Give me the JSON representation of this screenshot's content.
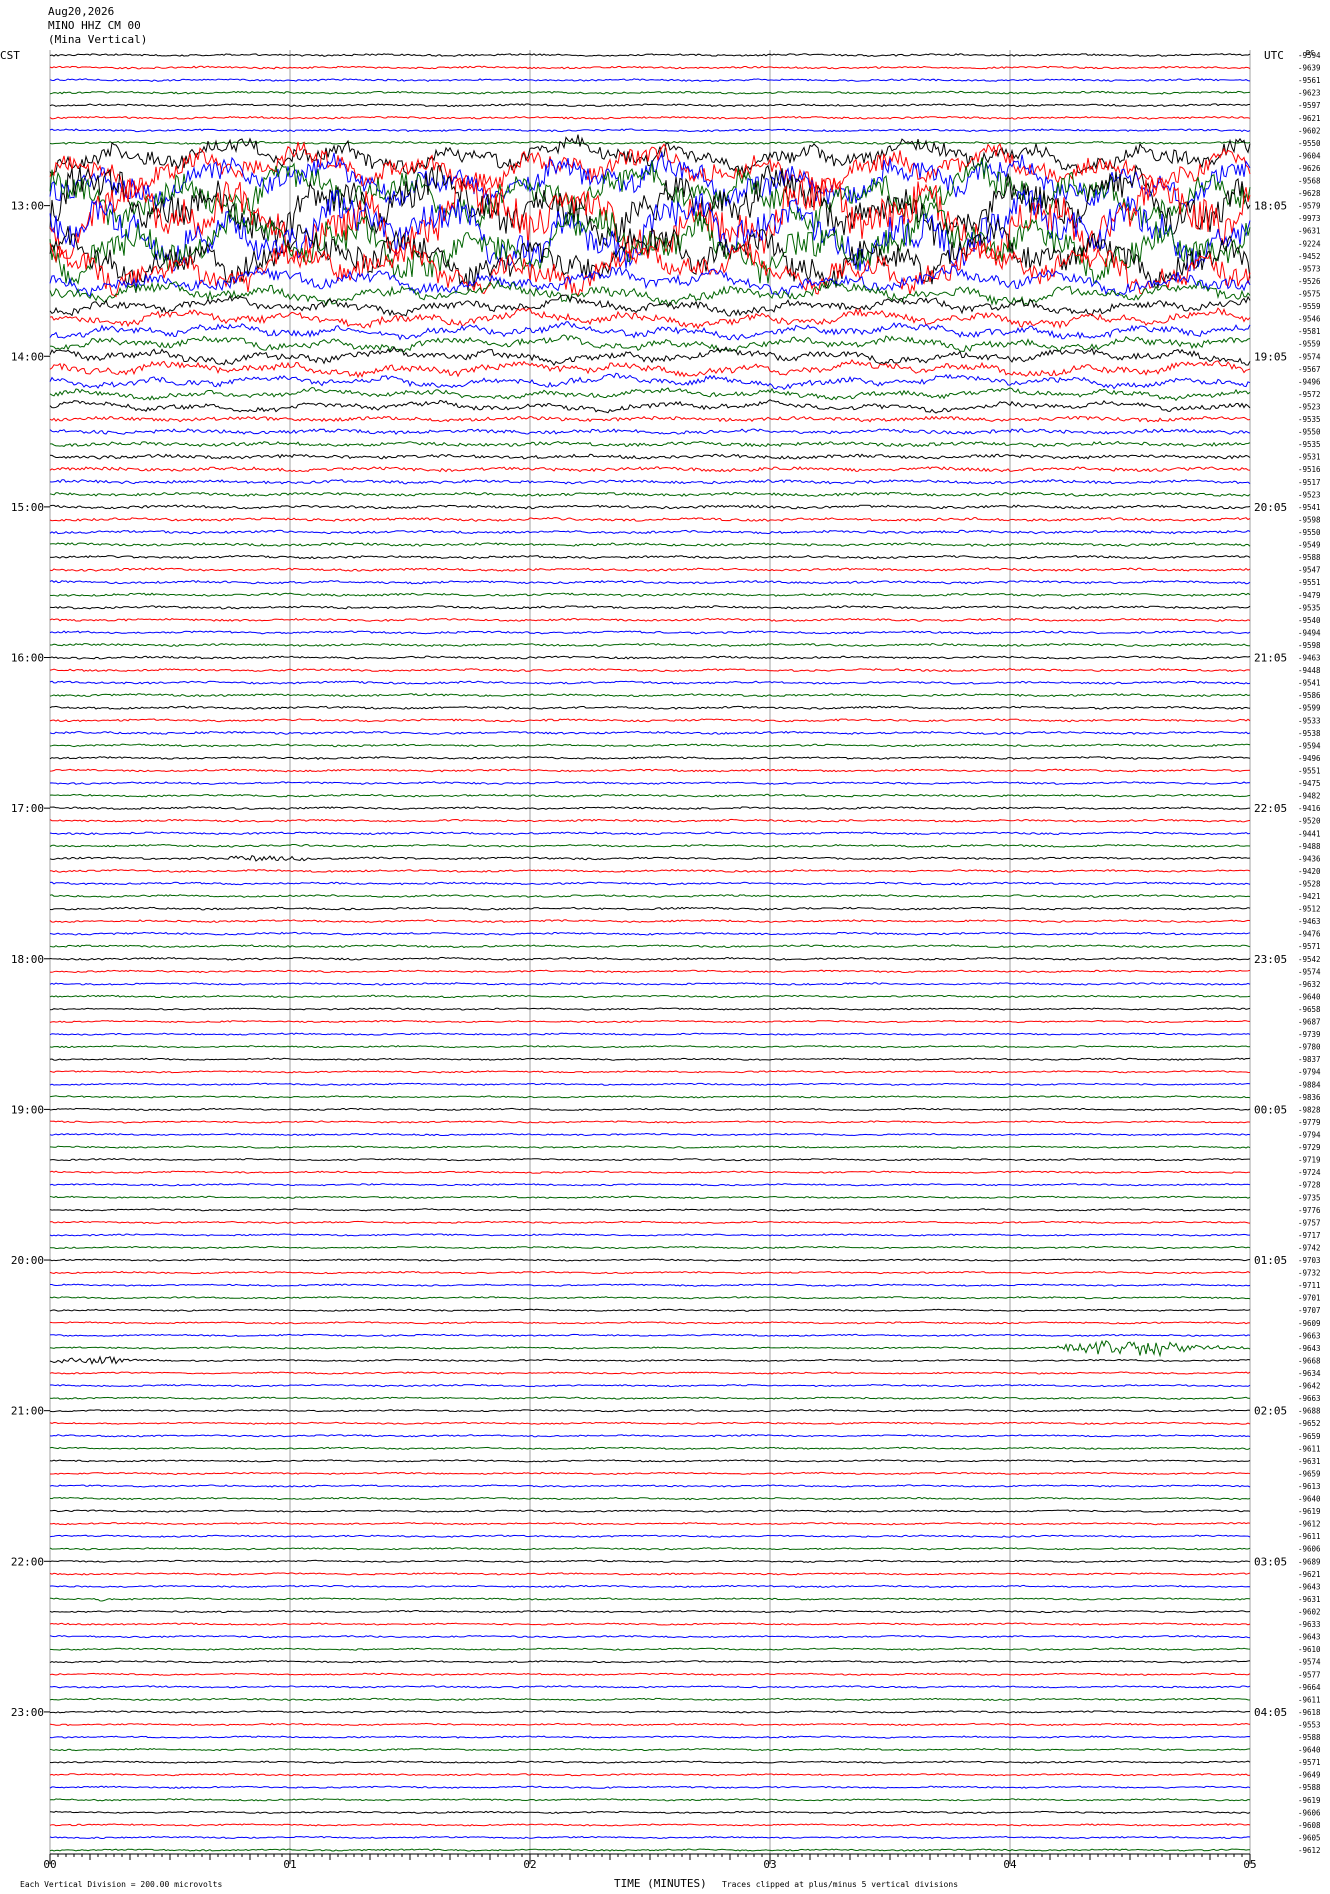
{
  "header": {
    "date": "Aug20,2026",
    "station": "MINO HHZ CM 00",
    "location": "(Mina Vertical)"
  },
  "left_zone_label": "CST",
  "right_zone_label": "UTC",
  "top_right_mark": "DC",
  "footer": {
    "scale_note": "Each Vertical Division = 200.00 microvolts",
    "axis_title": "TIME (MINUTES)",
    "clip_note": "Traces clipped at plus/minus 5 vertical divisions"
  },
  "colors": {
    "trace_cycle": [
      "#000000",
      "#ff0000",
      "#0000ff",
      "#006400"
    ],
    "grid": "#a0a0a0",
    "text": "#000000"
  },
  "chart_data": {
    "type": "line",
    "title": "",
    "x_ticks": [
      "00",
      "01",
      "02",
      "03",
      "04",
      "05"
    ],
    "x_range_minutes": [
      0,
      5
    ],
    "trace_minutes": 5,
    "trace_count": 144,
    "left_hour_labels": [
      "13:00",
      "14:00",
      "15:00",
      "16:00",
      "17:00",
      "18:00",
      "19:00",
      "20:00",
      "21:00",
      "22:00",
      "23:00"
    ],
    "right_hour_labels": [
      "18:05",
      "19:05",
      "20:05",
      "21:05",
      "22:05",
      "23:05",
      "00:05",
      "01:05",
      "02:05",
      "03:05",
      "04:05"
    ],
    "hour_label_trace_index": [
      12,
      24,
      36,
      48,
      60,
      72,
      84,
      96,
      108,
      120,
      132
    ],
    "trace_offsets": [
      -9594,
      -9639,
      -9561,
      -9623,
      -9597,
      -9621,
      -9602,
      -9550,
      -9604,
      -9626,
      -9568,
      -9628,
      -9579,
      -9973,
      -9631,
      -9224,
      -9452,
      -9573,
      -9526,
      -9575,
      -9559,
      -9546,
      -9581,
      -9559,
      -9574,
      -9567,
      -9496,
      -9572,
      -9523,
      -9535,
      -9550,
      -9535,
      -9531,
      -9516,
      -9517,
      -9523,
      -9541,
      -9598,
      -9550,
      -9549,
      -9588,
      -9547,
      -9551,
      -9479,
      -9535,
      -9540,
      -9494,
      -9598,
      -9463,
      -9448,
      -9541,
      -9586,
      -9599,
      -9533,
      -9538,
      -9594,
      -9496,
      -9551,
      -9475,
      -9482,
      -9416,
      -9520,
      -9441,
      -9488,
      -9436,
      -9420,
      -9528,
      -9421,
      -9512,
      -9463,
      -9476,
      -9571,
      -9542,
      -9574,
      -9632,
      -9640,
      -9658,
      -9687,
      -9739,
      -9780,
      -9837,
      -9794,
      -9884,
      -9836,
      -9828,
      -9779,
      -9794,
      -9729,
      -9719,
      -9724,
      -9728,
      -9735,
      -9776,
      -9757,
      -9717,
      -9742,
      -9703,
      -9732,
      -9711,
      -9701,
      -9707,
      -9609,
      -9663,
      -9643,
      -9668,
      -9634,
      -9642,
      -9663,
      -9688,
      -9652,
      -9659,
      -9611,
      -9631,
      -9659,
      -9613,
      -9640,
      -9619,
      -9612,
      -9611,
      -9606,
      -9689,
      -9621,
      -9643,
      -9631,
      -9602,
      -9633,
      -9643,
      -9610,
      -9574,
      -9577,
      -9664,
      -9611,
      -9618,
      -9553,
      -9588,
      -9640,
      -9571,
      -9649,
      -9588,
      -9619,
      -9606,
      -9608,
      -9605,
      -9612
    ],
    "trace_activity_level": [
      1,
      1,
      1,
      1,
      1,
      1,
      1,
      1,
      8,
      10,
      12,
      14,
      18,
      20,
      18,
      16,
      14,
      12,
      6,
      5,
      4,
      4,
      3.5,
      3.5,
      3.5,
      3.5,
      3,
      2.5,
      2.5,
      2,
      2,
      2,
      1.8,
      1.8,
      1.6,
      1.5,
      1.4,
      1.4,
      1.3,
      1.3,
      1.2,
      1.2,
      1.2,
      1.2,
      1.2,
      1.1,
      1.1,
      1.1,
      1.1,
      1.1,
      1.1,
      1.1,
      1.1,
      1.1,
      1.1,
      1,
      1,
      1,
      1,
      1,
      1,
      1,
      1,
      1,
      1,
      1,
      1,
      1,
      1,
      1,
      1,
      1,
      1,
      0.9,
      0.9,
      0.9,
      0.8,
      0.8,
      0.8,
      0.8,
      0.8,
      0.8,
      0.8,
      0.8,
      0.8,
      0.8,
      0.8,
      0.8,
      0.8,
      0.8,
      0.8,
      0.8,
      0.8,
      0.8,
      0.8,
      0.8,
      0.8,
      0.8,
      0.8,
      0.8,
      0.8,
      0.8,
      0.8,
      0.8,
      0.8,
      0.8,
      0.8,
      0.8,
      0.8,
      0.8,
      0.8,
      0.8,
      0.8,
      0.8,
      0.8,
      0.8,
      0.8,
      0.8,
      0.8,
      0.8,
      0.8,
      0.8,
      0.8,
      0.8,
      0.8,
      0.8,
      0.8,
      0.8,
      0.8,
      0.8,
      0.8,
      0.8,
      0.8,
      0.8,
      0.8,
      0.8,
      0.8,
      0.8,
      0.8,
      0.8,
      0.8,
      0.8
    ],
    "events": [
      {
        "trace": 103,
        "start_min": 4.2,
        "end_min": 5.0,
        "amplitude": 7
      },
      {
        "trace": 104,
        "start_min": 0.0,
        "end_min": 0.45,
        "amplitude": 4
      },
      {
        "trace": 123,
        "start_min": 0.18,
        "end_min": 0.25,
        "amplitude": 3
      },
      {
        "trace": 64,
        "start_min": 0.6,
        "end_min": 1.3,
        "amplitude": 2
      }
    ],
    "clip_divisions": 5
  }
}
